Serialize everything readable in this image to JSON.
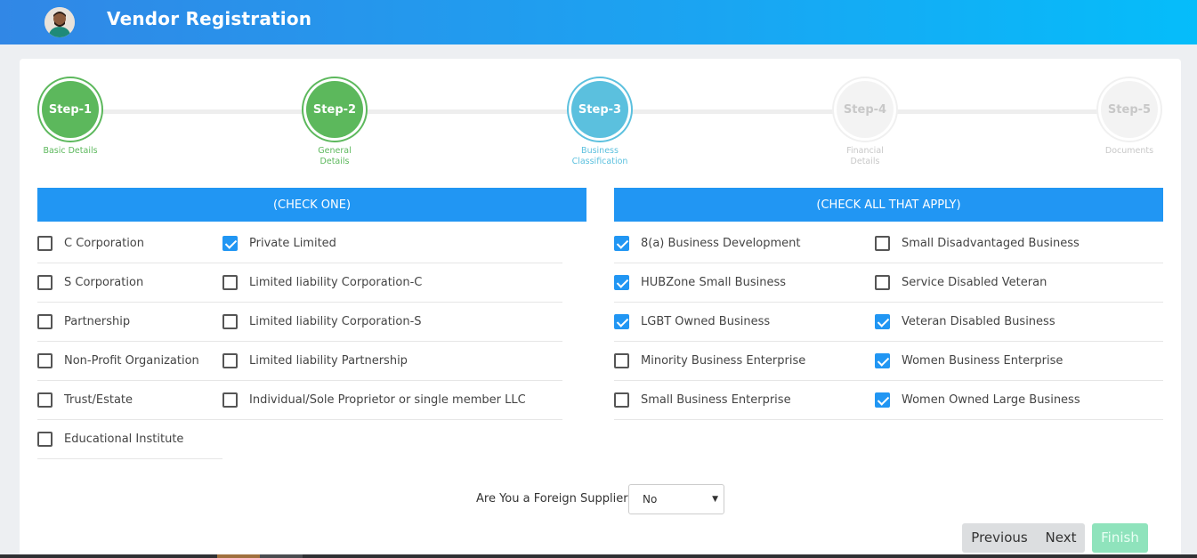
{
  "header": {
    "title": "Vendor Registration"
  },
  "steps": [
    {
      "label": "Step-1",
      "caption": "Basic Details",
      "state": "done"
    },
    {
      "label": "Step-2",
      "caption": "General Details",
      "state": "done"
    },
    {
      "label": "Step-3",
      "caption": "Business Classification",
      "state": "active"
    },
    {
      "label": "Step-4",
      "caption": "Financial Details",
      "state": "pending"
    },
    {
      "label": "Step-5",
      "caption": "Documents",
      "state": "pending"
    }
  ],
  "left_section": {
    "header": "(CHECK ONE)",
    "col1": [
      {
        "label": "C Corporation",
        "checked": false
      },
      {
        "label": "S Corporation",
        "checked": false
      },
      {
        "label": "Partnership",
        "checked": false
      },
      {
        "label": "Non-Profit Organization",
        "checked": false
      },
      {
        "label": "Trust/Estate",
        "checked": false
      },
      {
        "label": "Educational Institute",
        "checked": false
      }
    ],
    "col2": [
      {
        "label": "Private Limited",
        "checked": true
      },
      {
        "label": "Limited liability Corporation-C",
        "checked": false
      },
      {
        "label": "Limited liability Corporation-S",
        "checked": false
      },
      {
        "label": "Limited liability Partnership",
        "checked": false
      },
      {
        "label": "Individual/Sole Proprietor or single member LLC",
        "checked": false
      }
    ]
  },
  "right_section": {
    "header": "(CHECK ALL THAT APPLY)",
    "col1": [
      {
        "label": "8(a) Business Development",
        "checked": true
      },
      {
        "label": "HUBZone Small Business",
        "checked": true
      },
      {
        "label": "LGBT Owned Business",
        "checked": true
      },
      {
        "label": "Minority Business Enterprise",
        "checked": false
      },
      {
        "label": "Small Business Enterprise",
        "checked": false
      }
    ],
    "col2": [
      {
        "label": "Small Disadvantaged Business",
        "checked": false
      },
      {
        "label": "Service Disabled Veteran",
        "checked": false
      },
      {
        "label": "Veteran Disabled Business",
        "checked": true
      },
      {
        "label": "Women Business Enterprise",
        "checked": true
      },
      {
        "label": "Women Owned Large Business",
        "checked": true
      }
    ]
  },
  "foreign": {
    "label": "Are You a Foreign Supplier",
    "value": "No"
  },
  "buttons": {
    "previous": "Previous",
    "next": "Next",
    "finish": "Finish"
  },
  "colors": {
    "header_blue": "#2196f3",
    "step_done": "#5cb85c",
    "step_active": "#5bc0de",
    "finish": "#8fe3bc"
  }
}
